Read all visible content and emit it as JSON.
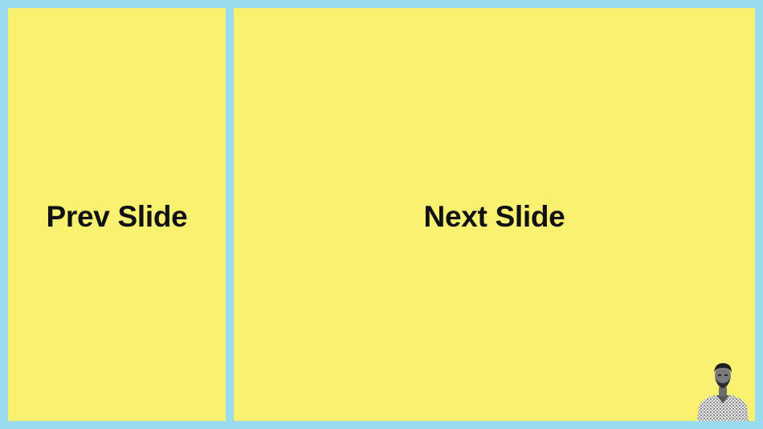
{
  "zones": {
    "prev_label": "Prev Slide",
    "next_label": "Next Slide"
  },
  "colors": {
    "frame_background": "#9adbf0",
    "zone_background": "#faf171",
    "label_text": "#111111"
  },
  "avatar": {
    "icon": "presenter-avatar"
  }
}
